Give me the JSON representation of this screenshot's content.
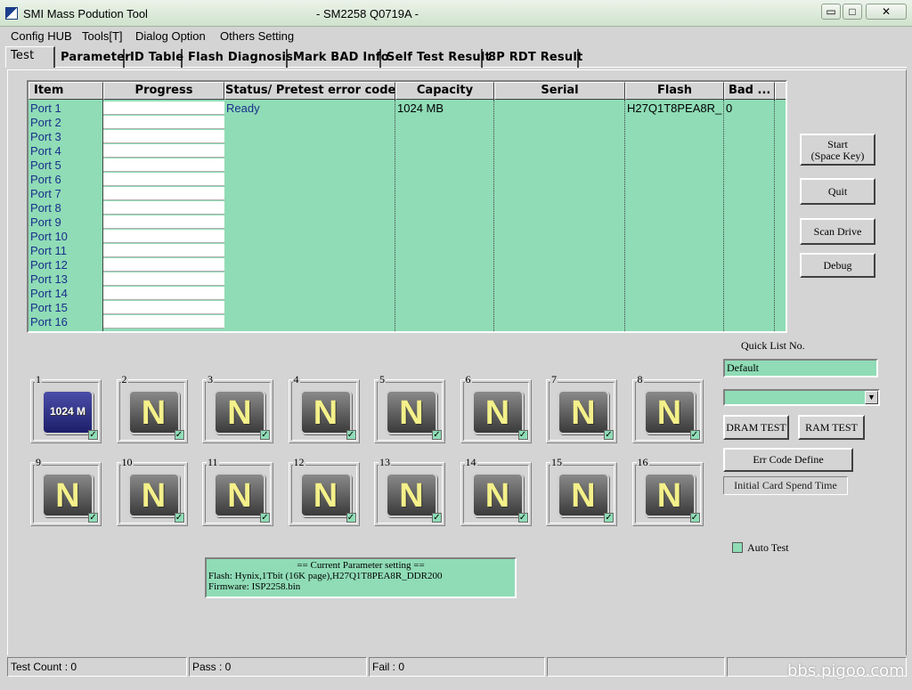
{
  "window": {
    "title": "SMI Mass Podution Tool",
    "subtitle": "- SM2258 Q0719A -",
    "minimize": "▭",
    "maximize": "□",
    "close": "✕"
  },
  "menu": [
    "Config HUB",
    "Tools[T]",
    "Dialog Option",
    "Others Setting"
  ],
  "tabs": [
    "Test",
    "Parameter",
    "ID Table",
    "Flash Diagnosis",
    "Mark BAD Info",
    "Self Test Result",
    "8P RDT Result"
  ],
  "grid": {
    "headers": [
      "Item",
      "Progress",
      "Status/ Pretest error code",
      "Capacity",
      "Serial",
      "Flash",
      "Bad ..."
    ],
    "ports": [
      "Port 1",
      "Port 2",
      "Port 3",
      "Port 4",
      "Port 5",
      "Port 6",
      "Port 7",
      "Port 8",
      "Port 9",
      "Port 10",
      "Port 11",
      "Port 12",
      "Port 13",
      "Port 14",
      "Port 15",
      "Port 16"
    ],
    "row1": {
      "status": "Ready",
      "capacity": "1024 MB",
      "flash": "H27Q1T8PEA8R_",
      "bad": "0"
    }
  },
  "buttons": {
    "start_line1": "Start",
    "start_line2": "(Space Key)",
    "quit": "Quit",
    "scan_drive": "Scan Drive",
    "debug": "Debug",
    "dram_test": "DRAM TEST",
    "ram_test": "RAM TEST",
    "err_code_define": "Err Code Define"
  },
  "quick_list": {
    "label": "Quick List No.",
    "value": "Default",
    "combo_arrow": "▼"
  },
  "initial_card_spend_time": "Initial Card Spend Time",
  "auto_test": "Auto Test",
  "slots": [
    {
      "num": "1",
      "label": "1024 M",
      "checked": "✓"
    },
    {
      "num": "2",
      "label": "N",
      "checked": "✓"
    },
    {
      "num": "3",
      "label": "N",
      "checked": "✓"
    },
    {
      "num": "4",
      "label": "N",
      "checked": "✓"
    },
    {
      "num": "5",
      "label": "N",
      "checked": "✓"
    },
    {
      "num": "6",
      "label": "N",
      "checked": "✓"
    },
    {
      "num": "7",
      "label": "N",
      "checked": "✓"
    },
    {
      "num": "8",
      "label": "N",
      "checked": "✓"
    },
    {
      "num": "9",
      "label": "N",
      "checked": "✓"
    },
    {
      "num": "10",
      "label": "N",
      "checked": "✓"
    },
    {
      "num": "11",
      "label": "N",
      "checked": "✓"
    },
    {
      "num": "12",
      "label": "N",
      "checked": "✓"
    },
    {
      "num": "13",
      "label": "N",
      "checked": "✓"
    },
    {
      "num": "14",
      "label": "N",
      "checked": "✓"
    },
    {
      "num": "15",
      "label": "N",
      "checked": "✓"
    },
    {
      "num": "16",
      "label": "N",
      "checked": "✓"
    }
  ],
  "param": {
    "title": "== Current Parameter setting ==",
    "flash": "Flash:   Hynix,1Tbit (16K page),H27Q1T8PEA8R_DDR200",
    "firmware": "Firmware:   ISP2258.bin"
  },
  "statusbar": {
    "test_count": "Test Count : 0",
    "pass": "Pass : 0",
    "fail": "Fail : 0"
  },
  "watermark": "bbs.pigoo.com",
  "colors": {
    "grid_bg": "#8fdcb6",
    "window_bg": "#d4d4d4",
    "port_text": "#1a2f8a"
  }
}
